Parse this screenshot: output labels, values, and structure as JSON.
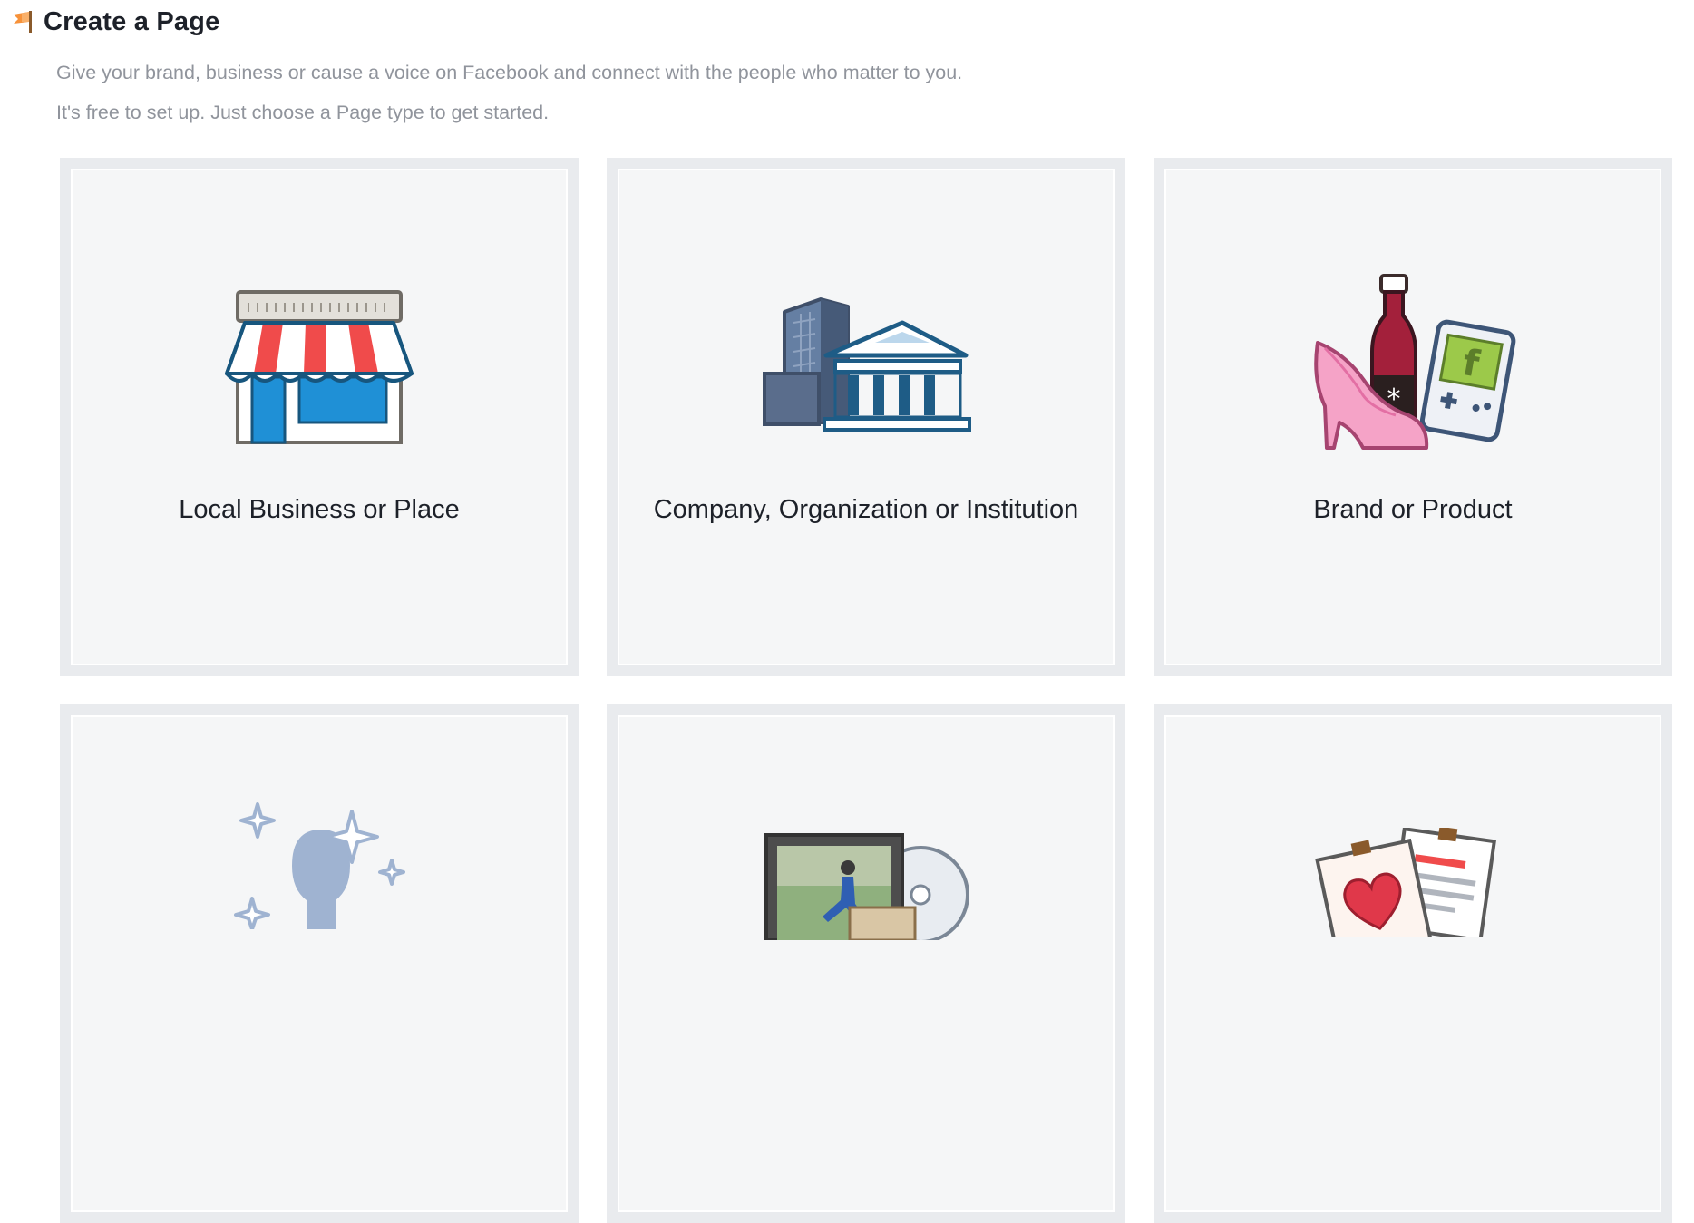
{
  "header": {
    "title": "Create a Page",
    "subtitle_line1": "Give your brand, business or cause a voice on Facebook and connect with the people who matter to you.",
    "subtitle_line2": "It's free to set up. Just choose a Page type to get started."
  },
  "page_types": [
    {
      "label": "Local Business or Place",
      "icon": "storefront-icon"
    },
    {
      "label": "Company, Organization or Institution",
      "icon": "office-buildings-icon"
    },
    {
      "label": "Brand or Product",
      "icon": "products-icon"
    },
    {
      "label": "",
      "icon": "public-figure-icon"
    },
    {
      "label": "",
      "icon": "entertainment-icon"
    },
    {
      "label": "",
      "icon": "cause-community-icon"
    }
  ],
  "colors": {
    "card_bg": "#f5f6f7",
    "card_border": "#e9ebee",
    "title": "#1d2129",
    "subtitle": "#90949c",
    "awning_red": "#f04b4b",
    "store_blue": "#1f90d6"
  }
}
